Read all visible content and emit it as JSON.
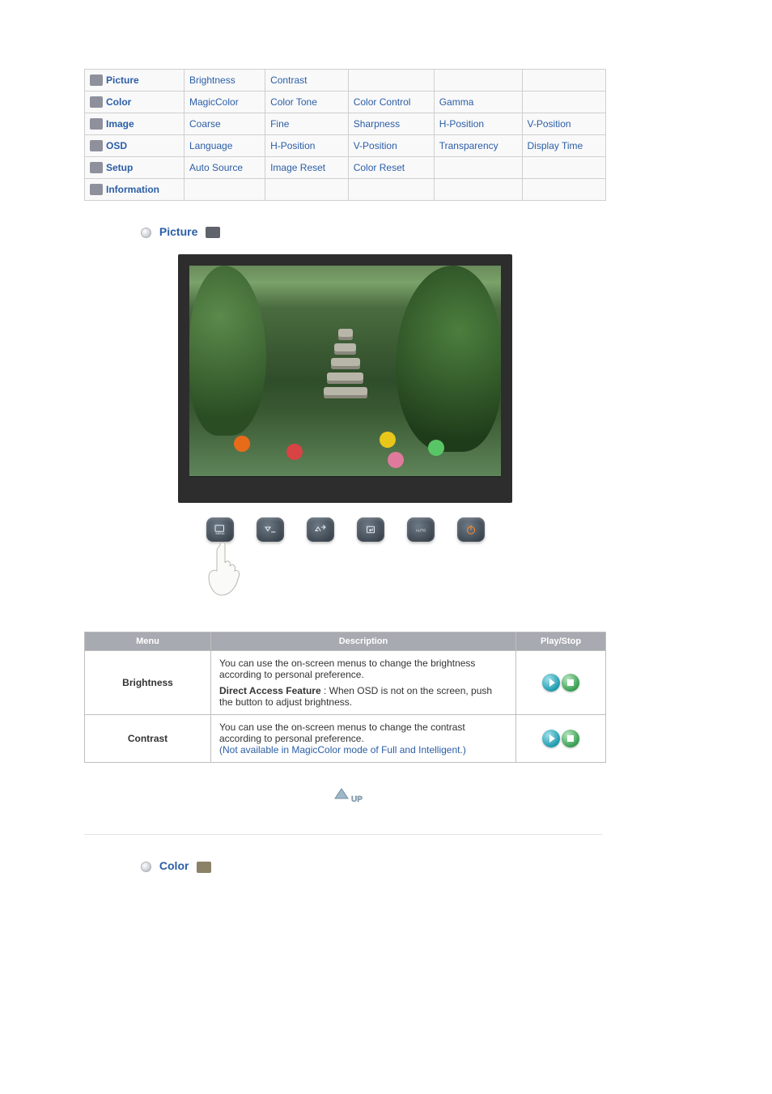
{
  "menu": {
    "rows": [
      {
        "category": "Picture",
        "items": [
          "Brightness",
          "Contrast",
          "",
          "",
          ""
        ]
      },
      {
        "category": "Color",
        "items": [
          "MagicColor",
          "Color Tone",
          "Color Control",
          "Gamma",
          ""
        ]
      },
      {
        "category": "Image",
        "items": [
          "Coarse",
          "Fine",
          "Sharpness",
          "H-Position",
          "V-Position"
        ]
      },
      {
        "category": "OSD",
        "items": [
          "Language",
          "H-Position",
          "V-Position",
          "Transparency",
          "Display Time"
        ]
      },
      {
        "category": "Setup",
        "items": [
          "Auto Source",
          "Image Reset",
          "Color Reset",
          "",
          ""
        ]
      },
      {
        "category": "Information",
        "items": [
          "",
          "",
          "",
          "",
          ""
        ]
      }
    ]
  },
  "sections": {
    "picture_title": "Picture",
    "color_title": "Color"
  },
  "monitor_buttons": {
    "menu": "MENU",
    "auto": "AUTO"
  },
  "desc_table": {
    "headers": {
      "menu": "Menu",
      "description": "Description",
      "playstop": "Play/Stop"
    },
    "rows": [
      {
        "menu": "Brightness",
        "desc_line1": "You can use the on-screen menus to change the brightness according to personal preference.",
        "desc_bold": "Direct Access Feature",
        "desc_cont": " : When OSD is not on the screen, push the button to adjust brightness.",
        "note": ""
      },
      {
        "menu": "Contrast",
        "desc_line1": "You can use the on-screen menus to change the contrast according to personal preference.",
        "desc_bold": "",
        "desc_cont": "",
        "note": "(Not available in MagicColor mode of Full and Intelligent.)"
      }
    ]
  }
}
